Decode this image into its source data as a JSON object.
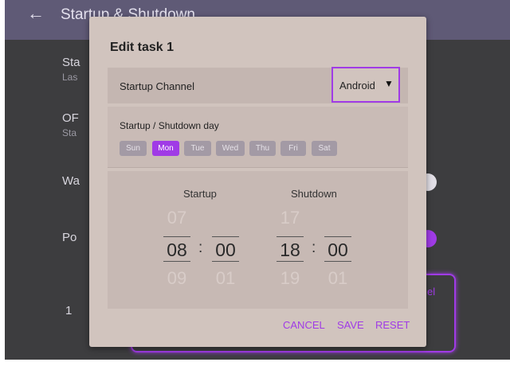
{
  "header": {
    "title": "Startup & Shutdown",
    "back_icon": "arrow-left-icon"
  },
  "background": {
    "items": [
      {
        "label": "Sta",
        "sub": "Las"
      },
      {
        "label": "OF",
        "sub": "Sta"
      },
      {
        "label": "Wa"
      },
      {
        "label": "Po"
      }
    ],
    "list_number": "1",
    "box_text": "el"
  },
  "dialog": {
    "title": "Edit task 1",
    "channel": {
      "label": "Startup Channel",
      "value": "Android",
      "caret_icon": "caret-down-icon"
    },
    "day": {
      "label": "Startup / Shutdown day",
      "days": [
        "Sun",
        "Mon",
        "Tue",
        "Wed",
        "Thu",
        "Fri",
        "Sat"
      ],
      "selected": "Mon"
    },
    "time": {
      "startup_label": "Startup",
      "shutdown_label": "Shutdown",
      "startup": {
        "hour_prev": "07",
        "hour": "08",
        "hour_next": "09",
        "min_prev": "",
        "min": "00",
        "min_next": "01"
      },
      "shutdown": {
        "hour_prev": "17",
        "hour": "18",
        "hour_next": "19",
        "min_prev": "",
        "min": "00",
        "min_next": "01"
      },
      "separator": ":"
    },
    "buttons": {
      "cancel": "CANCEL",
      "save": "SAVE",
      "reset": "RESET"
    }
  },
  "colors": {
    "accent": "#a03be6",
    "dialog_bg": "#d1c4be",
    "header_bg": "#5f5a76"
  }
}
